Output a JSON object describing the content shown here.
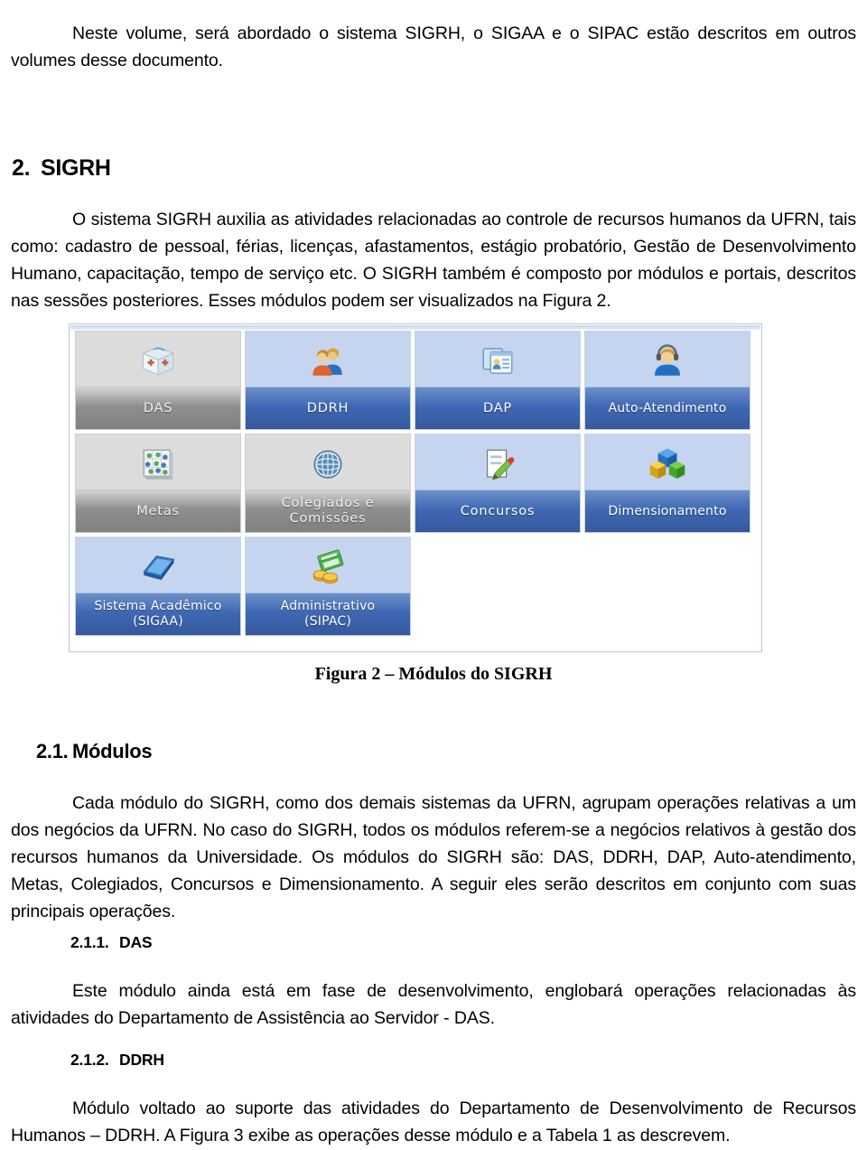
{
  "document": {
    "intro_paragraph": "Neste volume, será abordado o sistema SIGRH, o SIGAA e o SIPAC estão descritos em outros volumes desse documento.",
    "section_2": {
      "number": "2.",
      "title": "SIGRH",
      "paragraph": "O sistema SIGRH auxilia as atividades relacionadas ao controle de recursos humanos da UFRN, tais como: cadastro de pessoal, férias, licenças, afastamentos, estágio probatório, Gestão de Desenvolvimento Humano, capacitação, tempo de serviço etc. O SIGRH também é composto por módulos e portais, descritos nas sessões posteriores. Esses módulos podem ser visualizados na Figura 2."
    },
    "figure_2": {
      "caption": "Figura 2 – Módulos do SIGRH",
      "tiles": [
        {
          "label": "DAS",
          "icon": "first-aid-box-icon",
          "state": "disabled"
        },
        {
          "label": "DDRH",
          "icon": "two-people-icon",
          "state": "enabled"
        },
        {
          "label": "DAP",
          "icon": "id-card-window-icon",
          "state": "enabled"
        },
        {
          "label": "Auto-Atendimento",
          "icon": "headset-person-icon",
          "state": "enabled"
        },
        {
          "label": "Metas",
          "icon": "grid-nodes-icon",
          "state": "disabled"
        },
        {
          "label": "Colegiados e\nComissões",
          "icon": "globe-icon",
          "state": "disabled"
        },
        {
          "label": "Concursos",
          "icon": "document-pencil-icon",
          "state": "enabled"
        },
        {
          "label": "Dimensionamento",
          "icon": "three-cubes-icon",
          "state": "enabled"
        },
        {
          "label": "Sistema Acadêmico\n(SIGAA)",
          "icon": "blue-book-icon",
          "state": "enabled"
        },
        {
          "label": "Administrativo\n(SIPAC)",
          "icon": "money-coins-icon",
          "state": "enabled"
        }
      ]
    },
    "section_2_1": {
      "number": "2.1.",
      "title": "Módulos",
      "paragraph": "Cada módulo do SIGRH, como dos demais sistemas da UFRN, agrupam operações relativas a um dos negócios da UFRN. No caso do SIGRH, todos os módulos referem-se a negócios relativos à gestão dos recursos humanos da Universidade. Os módulos do SIGRH são: DAS, DDRH, DAP, Auto-atendimento, Metas, Colegiados, Concursos e Dimensionamento. A seguir eles serão descritos em conjunto com suas principais operações."
    },
    "section_2_1_1": {
      "number": "2.1.1.",
      "title": "DAS",
      "paragraph": "Este módulo ainda está em fase de desenvolvimento, englobará operações relacionadas às atividades do Departamento de Assistência ao Servidor - DAS."
    },
    "section_2_1_2": {
      "number": "2.1.2.",
      "title": "DDRH",
      "paragraph": "Módulo voltado ao suporte das atividades do Departamento de Desenvolvimento de Recursos Humanos – DDRH.  A Figura 3 exibe as operações desse módulo e a Tabela 1 as descrevem."
    },
    "colors": {
      "tile_enabled_body": "#c5d5ef",
      "tile_enabled_bar": "#3f69b4",
      "tile_disabled_body": "#dcdcdc",
      "tile_disabled_bar": "#8f8f8f",
      "figure_border": "#b9c6de",
      "text": "#000000"
    }
  }
}
